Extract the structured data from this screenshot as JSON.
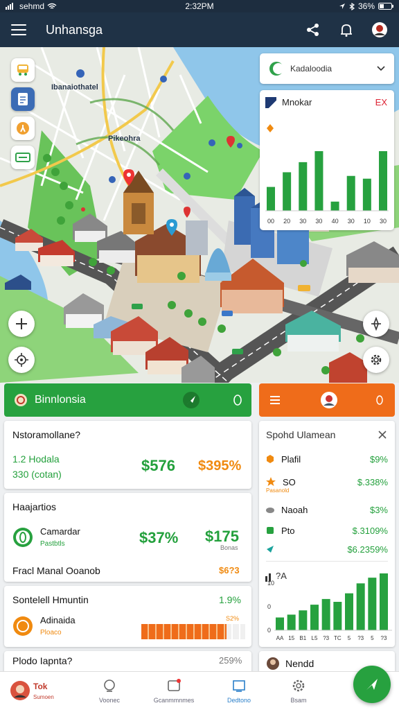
{
  "status": {
    "left": "sehmd",
    "time": "2:32PM",
    "battery": "36%"
  },
  "appbar": {
    "title": "Unhansga"
  },
  "map": {
    "labels": [
      "Ibanaiothatel",
      "Pikeohra"
    ],
    "layer_select": {
      "label": "Kadaloodia"
    },
    "chart_card": {
      "title": "Mnokar",
      "close": "EX",
      "values": [
        26,
        42,
        53,
        65,
        10,
        38,
        35,
        65
      ],
      "ticks": [
        "00",
        "20",
        "30",
        "30",
        "40",
        "30",
        "10",
        "30"
      ]
    }
  },
  "panel_left": {
    "header": {
      "label": "Binnlonsia"
    },
    "section1": {
      "title": "Nstoramollane?",
      "line1": "1.2 Hodala",
      "line2": "330 (cotan)",
      "value1": "$576",
      "value2": "$395%"
    },
    "section2": {
      "title": "Haajartios",
      "item_title": "Camardar",
      "item_sub": "Pastbtls",
      "value1": "$37%",
      "value2": "$175",
      "value2_sub": "Bonas",
      "footer_label": "Fracl Manal Ooanob",
      "footer_value": "$6?3"
    },
    "section3": {
      "title": "Sontelell Hmuntin",
      "value": "1.9%",
      "item_title": "Adinaida",
      "item_sub": "Ploaco",
      "bar_label": "S2%",
      "bar_level": 0.82
    },
    "section4": {
      "title": "Plodo Iapnta?",
      "value": "259%"
    }
  },
  "panel_right": {
    "header": {},
    "list": {
      "title": "Spohd Ulamean",
      "items": [
        {
          "label": "Plafil",
          "value": "$9%",
          "sub": ""
        },
        {
          "label": "SO",
          "value": "$.338%",
          "sub": "Pasanold"
        },
        {
          "label": "Naoah",
          "value": "$3%",
          "sub": ""
        },
        {
          "label": "Pto",
          "value": "$.3109%",
          "sub": ""
        },
        {
          "label": "",
          "value": "$6.2359%",
          "sub": ""
        }
      ],
      "chart": {
        "label": "?A",
        "ylabels": [
          "0",
          "0",
          "10"
        ],
        "values": [
          18,
          22,
          28,
          36,
          44,
          40,
          52,
          66,
          74,
          80
        ],
        "xticks": [
          "AA",
          "15",
          "B1",
          "L5",
          "?3",
          "TC",
          "5",
          "?3",
          "5",
          "?3"
        ]
      }
    },
    "footer": {
      "label": "Nendd"
    }
  },
  "bottomnav": {
    "items": [
      "Voonec",
      "Gcanmmnmes",
      "Dedtono",
      "Bsam"
    ],
    "first": {
      "title": "Tok",
      "sub": "Sumoen"
    }
  },
  "colors": {
    "green": "#27a13f",
    "orange": "#ef6c1a",
    "appbar": "#1f3246"
  }
}
